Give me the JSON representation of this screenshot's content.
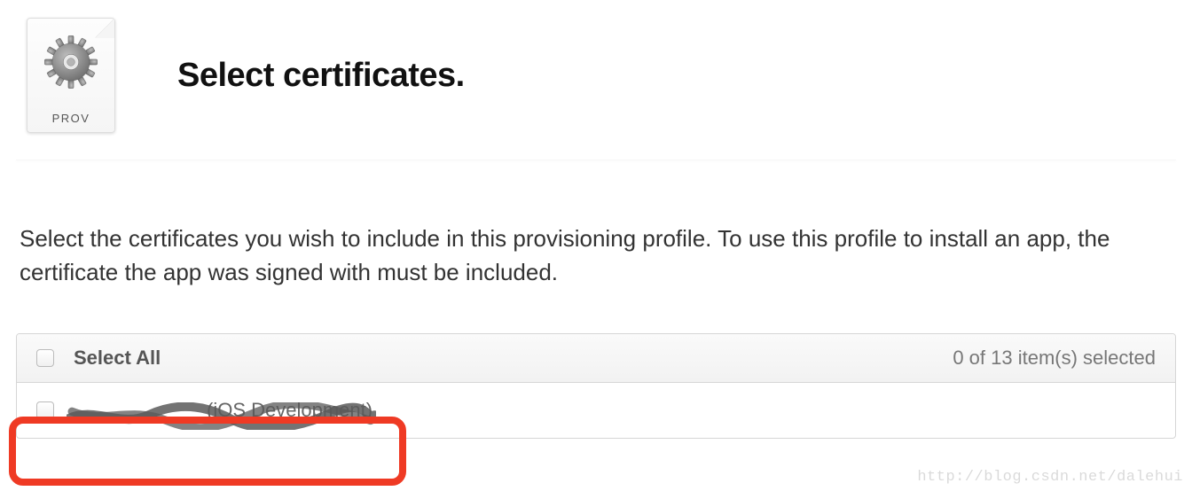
{
  "header": {
    "icon_label": "PROV",
    "title": "Select certificates."
  },
  "description": "Select the certificates you wish to include in this provisioning profile. To use this profile to install an app, the certificate the app was signed with must be included.",
  "certificates": {
    "select_all_label": "Select All",
    "selected_count": 0,
    "total_count": 13,
    "count_text": "0 of 13 item(s) selected",
    "items": [
      {
        "name_redacted": true,
        "suffix": "(iOS Development)"
      }
    ]
  },
  "watermark": "http://blog.csdn.net/dalehui"
}
